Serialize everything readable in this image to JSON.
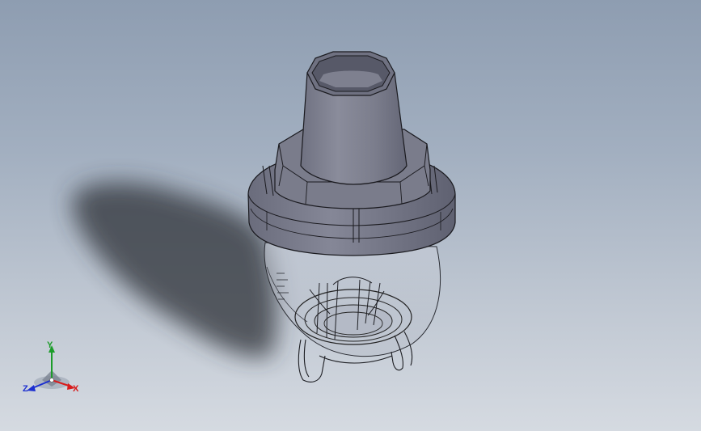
{
  "viewport": {
    "background_top": "#8e9db1",
    "background_bottom": "#d5dae1",
    "model_color": "#7d7f8f",
    "edge_color": "#1a1a1f",
    "shadow_color": "#3a3d44"
  },
  "triad": {
    "x_label": "X",
    "y_label": "Y",
    "z_label": "Z",
    "x_color": "#d81c1c",
    "y_color": "#1c9c2a",
    "z_color": "#1c2fd0"
  },
  "model": {
    "name": "nebulizer-cup-assembly",
    "parts": [
      "mouthpiece-tube",
      "octagonal-collar",
      "cap-ring",
      "transparent-bowl",
      "inner-baffle",
      "support-legs"
    ]
  }
}
